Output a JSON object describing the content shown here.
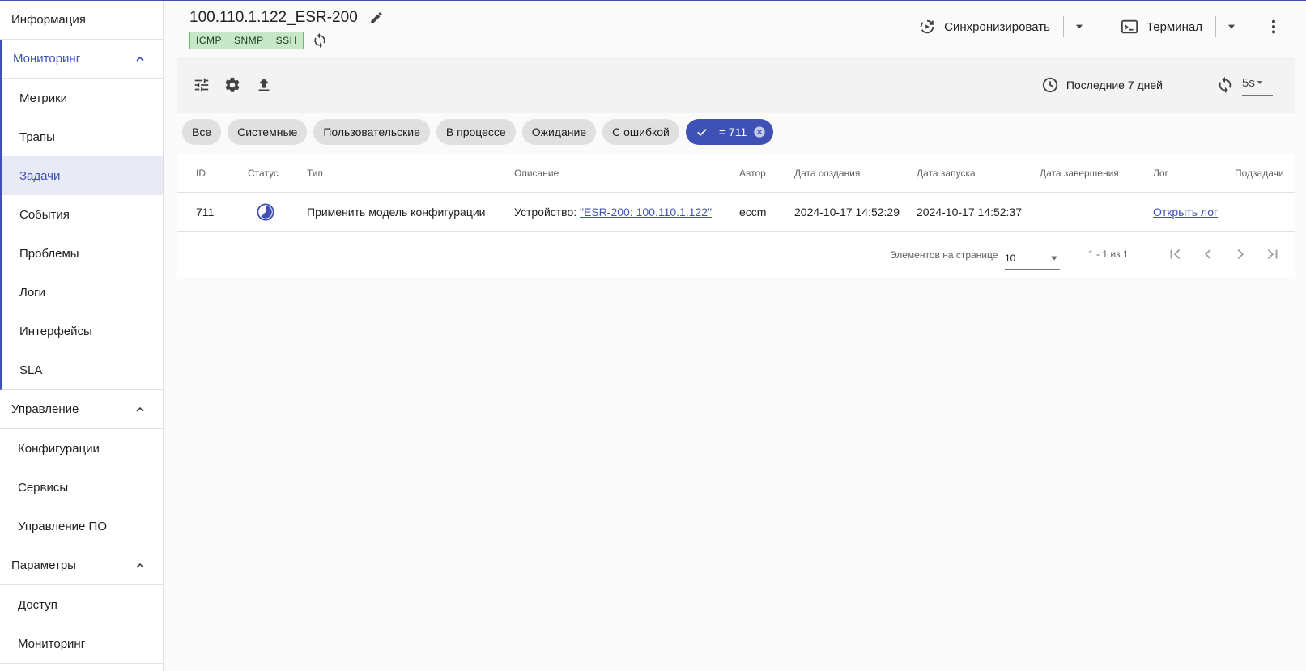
{
  "sidebar": {
    "info": "Информация",
    "monitoring": {
      "title": "Мониторинг",
      "items": [
        "Метрики",
        "Трапы",
        "Задачи",
        "События",
        "Проблемы",
        "Логи",
        "Интерфейсы",
        "SLA"
      ]
    },
    "management": {
      "title": "Управление",
      "items": [
        "Конфигурации",
        "Сервисы",
        "Управление ПО"
      ]
    },
    "params": {
      "title": "Параметры",
      "items": [
        "Доступ",
        "Мониторинг"
      ]
    }
  },
  "header": {
    "title": "100.110.1.122_ESR-200",
    "badges": [
      "ICMP",
      "SNMP",
      "SSH"
    ],
    "sync_label": "Синхронизировать",
    "terminal_label": "Терминал"
  },
  "toolbar": {
    "period_label": "Последние 7 дней",
    "refresh_value": "5s"
  },
  "chips": {
    "items": [
      "Все",
      "Системные",
      "Пользовательские",
      "В процессе",
      "Ожидание",
      "С ошибкой"
    ],
    "active_filter": "= 711"
  },
  "table": {
    "headers": {
      "id": "ID",
      "status": "Статус",
      "type": "Тип",
      "description": "Описание",
      "author": "Автор",
      "created": "Дата создания",
      "started": "Дата запуска",
      "finished": "Дата завершения",
      "log": "Лог",
      "subtasks": "Подзадачи"
    },
    "rows": [
      {
        "id": "711",
        "type": "Применить модель конфигурации",
        "desc_prefix": "Устройство: ",
        "desc_link": "\"ESR-200: 100.110.1.122\"",
        "author": "eccm",
        "created": "2024-10-17 14:52:29",
        "started": "2024-10-17 14:52:37",
        "finished": "",
        "log_link": "Открыть лог",
        "subtasks": ""
      }
    ]
  },
  "paginator": {
    "per_page_label": "Элементов на странице",
    "per_page_value": "10",
    "range": "1 - 1 из 1"
  },
  "colors": {
    "accent": "#3f51b5",
    "badge_bg": "#c8e6c9",
    "badge_border": "#66bb6a"
  },
  "icons": {
    "edit": "pencil-icon",
    "sync": "sync-icon",
    "terminal": "terminal-icon",
    "filters": "tune-icon",
    "settings": "gear-icon",
    "upload": "upload-icon",
    "clock": "clock-icon",
    "refresh": "refresh-icon",
    "status": "in-progress-icon"
  }
}
